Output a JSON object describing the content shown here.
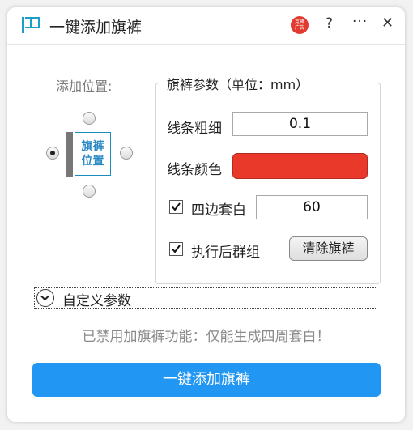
{
  "window": {
    "title": "一键添加旗裤",
    "brand_icon_text": "克峰\n广告",
    "help_label": "?",
    "more_label": "···",
    "close_label": "✕"
  },
  "position": {
    "label": "添加位置:",
    "preview_text_line1": "旗裤",
    "preview_text_line2": "位置",
    "selected": "left"
  },
  "params": {
    "legend": "旗裤参数（单位：mm）",
    "line_width_label": "线条粗细",
    "line_width_value": "0.1",
    "line_color_label": "线条颜色",
    "line_color": "#e8392a",
    "four_sides_label": "四边套白",
    "four_sides_checked": true,
    "four_sides_value": "60",
    "group_label": "执行后群组",
    "group_checked": true,
    "clear_button": "清除旗裤"
  },
  "custom": {
    "label": "自定义参数"
  },
  "notice": "已禁用加旗裤功能：仅能生成四周套白！",
  "primary_button": "一键添加旗裤",
  "colors": {
    "accent": "#2196f3",
    "swatch_red": "#e8392a",
    "preview_blue": "#2a89c4"
  }
}
